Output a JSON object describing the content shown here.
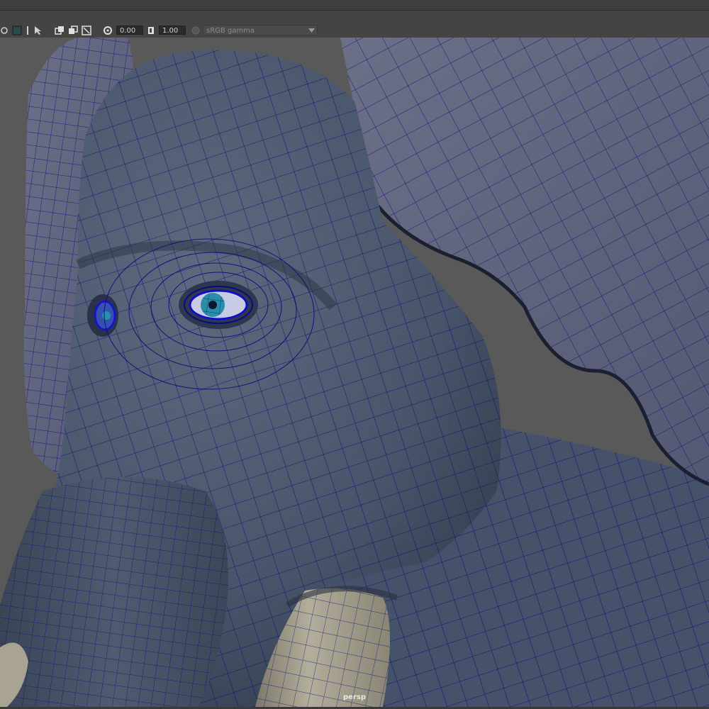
{
  "toolbar": {
    "icons": [
      "ring-icon",
      "grid-icon",
      "split-icon",
      "cursor-select-icon",
      "copy-icon",
      "paste-icon",
      "resize-icon",
      "exposure-icon",
      "gamma-icon",
      "color-management-icon"
    ],
    "exposure_value": "0.00",
    "gamma_value": "1.00",
    "color_space": "sRGB gamma"
  },
  "viewport": {
    "camera_label": "persp"
  },
  "colors": {
    "wire": "#0b0b7a",
    "skin": "#4a5668",
    "skin_light": "#5f6880",
    "ear": "#62647c",
    "tusk": "#a19c8b",
    "background": "#5a5a5a"
  }
}
